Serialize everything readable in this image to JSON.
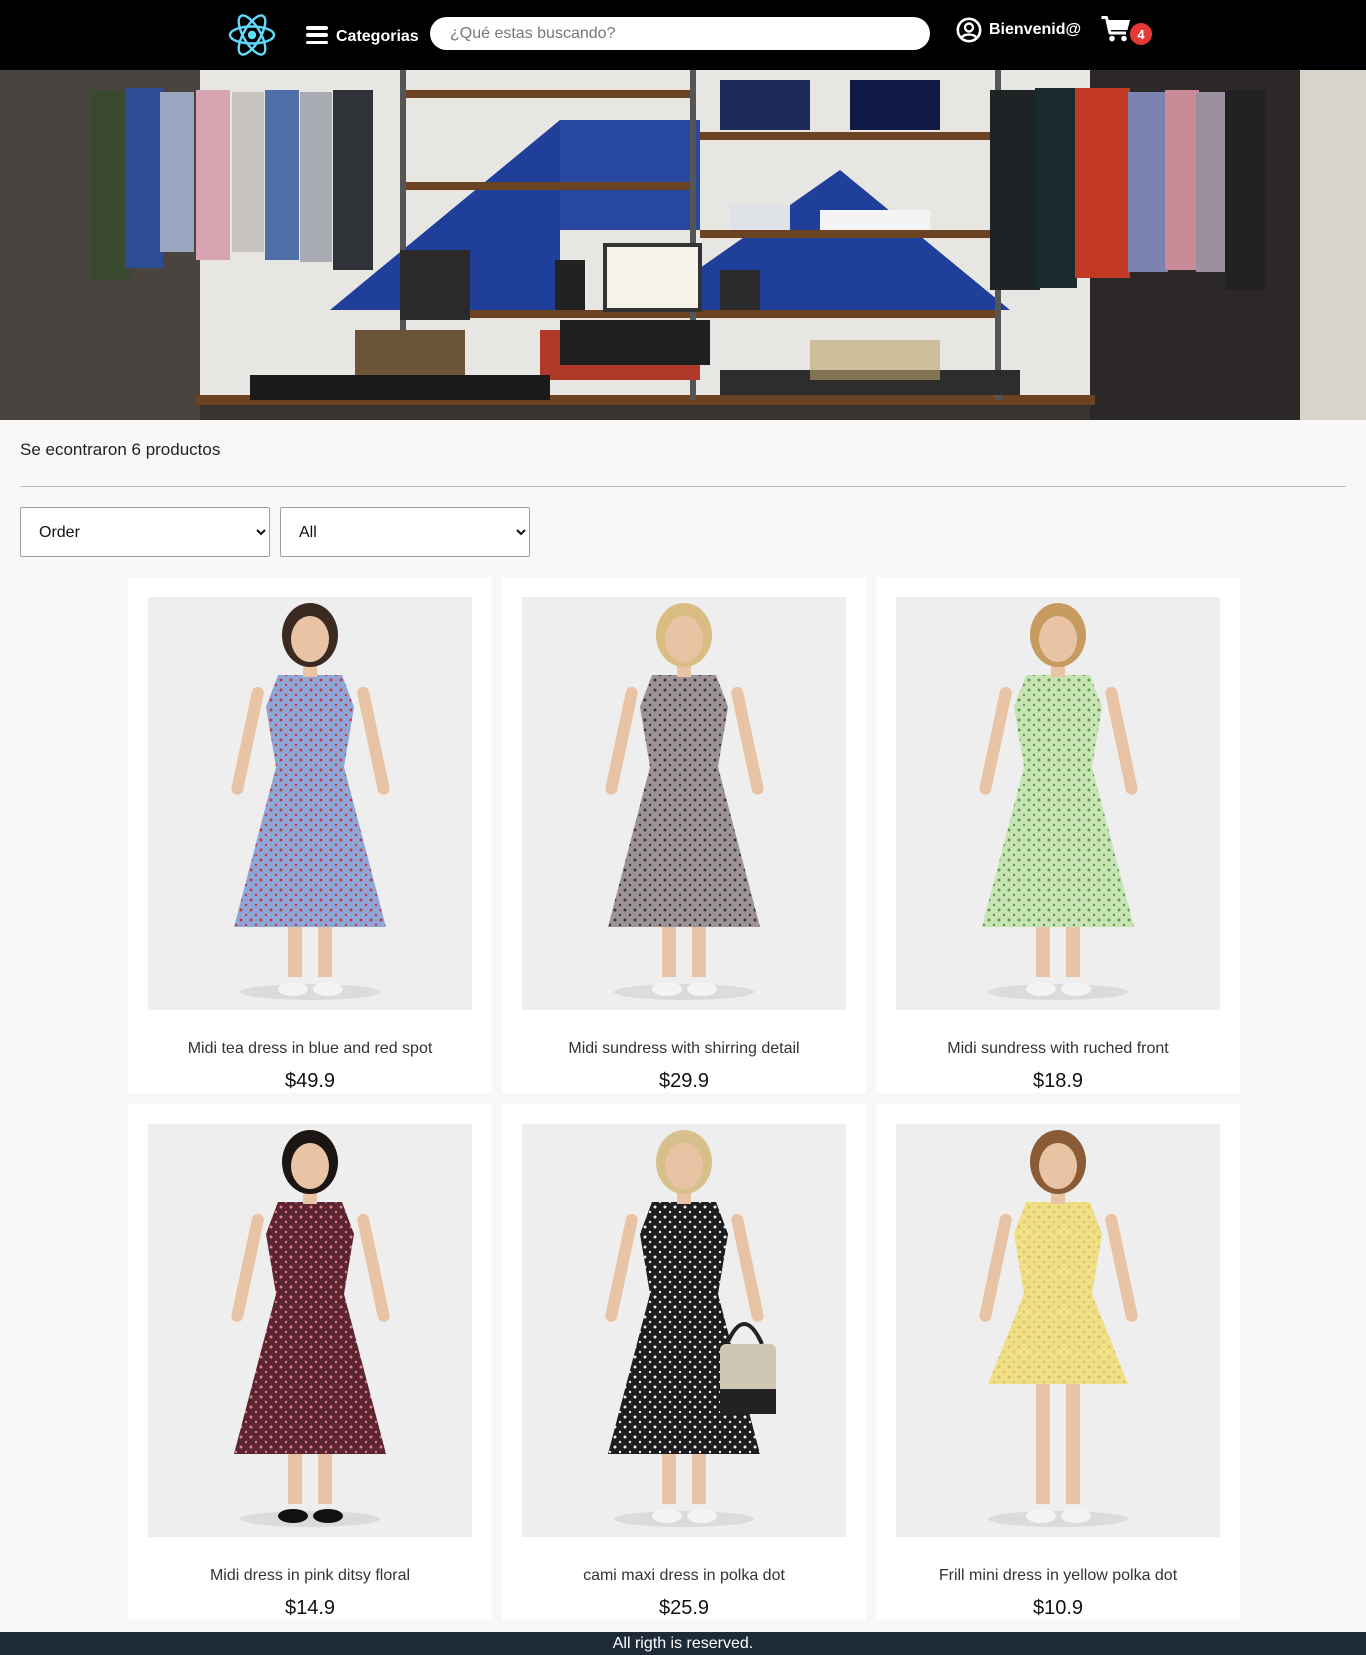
{
  "header": {
    "logo_icon": "react-atom-icon",
    "categories_label": "Categorias",
    "search_placeholder": "¿Qué estas buscando?",
    "user_label": "Bienvenid@",
    "cart_count": "4"
  },
  "results": {
    "count_text": "Se econtraron 6 productos"
  },
  "filters": {
    "order_selected": "Order",
    "category_selected": "All"
  },
  "products": [
    {
      "name": "Midi tea dress in blue and red spot",
      "price": "$49.9",
      "dress_color": "#8fa6d8",
      "dot_color": "#c0393d"
    },
    {
      "name": "Midi sundress with shirring detail",
      "price": "$29.9",
      "dress_color": "#9c9397",
      "dot_color": "#3a3336"
    },
    {
      "name": "Midi sundress with ruched front",
      "price": "$18.9",
      "dress_color": "#c9e4b4",
      "dot_color": "#5a9a4a"
    },
    {
      "name": "Midi dress in pink ditsy floral",
      "price": "$14.9",
      "dress_color": "#5a2530",
      "dot_color": "#e07a8c"
    },
    {
      "name": "cami maxi dress in polka dot",
      "price": "$25.9",
      "dress_color": "#1d1d1f",
      "dot_color": "#f1f1f1"
    },
    {
      "name": "Frill mini dress in yellow polka dot",
      "price": "$10.9",
      "dress_color": "#f0df86",
      "dot_color": "#d9c260"
    }
  ],
  "footer": {
    "text": "All rigth is reserved."
  }
}
